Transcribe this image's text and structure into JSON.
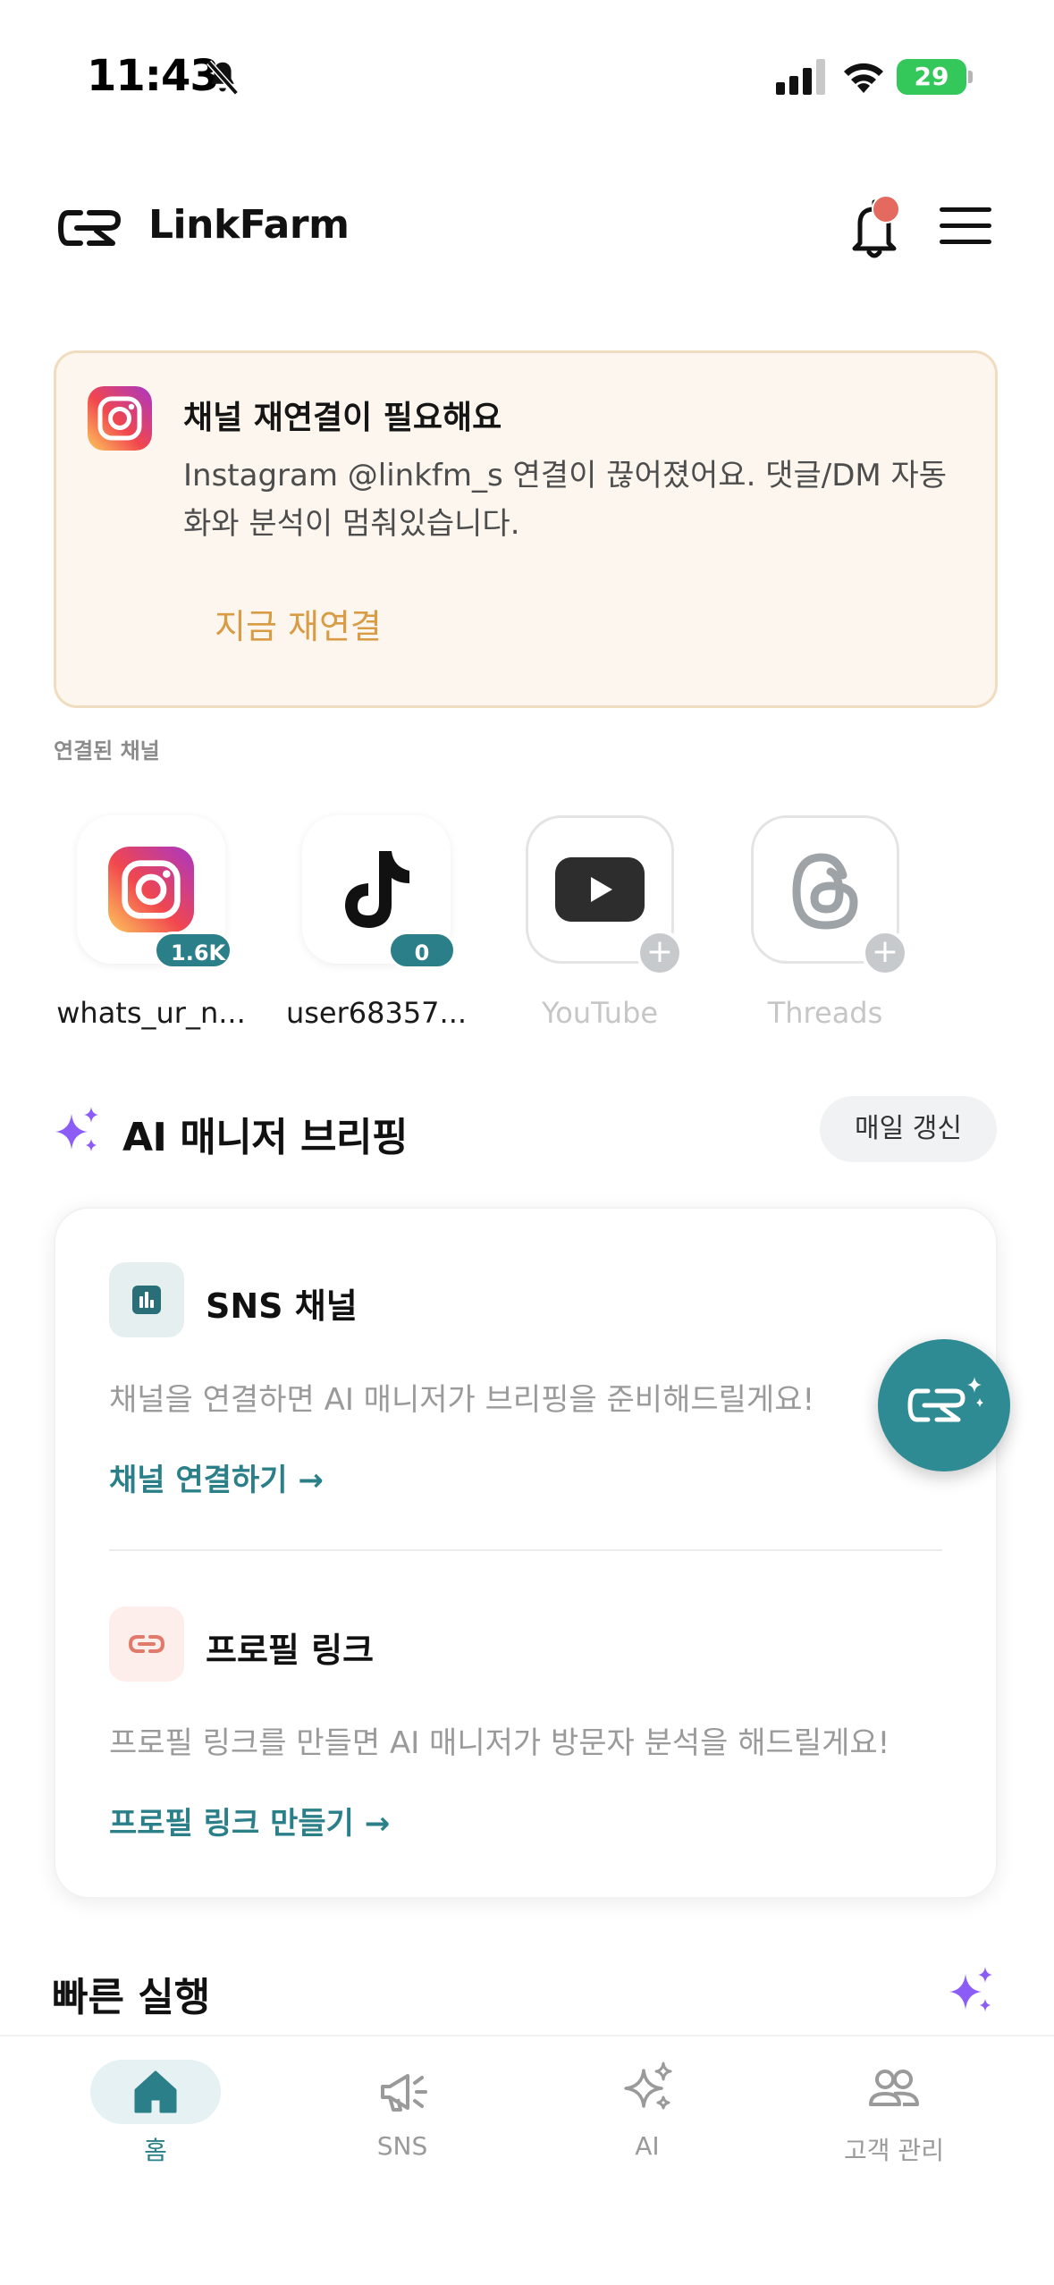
{
  "status_bar": {
    "time": "11:43",
    "battery": "29"
  },
  "header": {
    "brand": "LinkFarm"
  },
  "alert": {
    "title": "채널 재연결이 필요해요",
    "body": "Instagram @linkfm_s 연결이 끊어졌어요. 댓글/DM 자동화와 분석이 멈춰있습니다.",
    "action": "지금 재연결"
  },
  "channels": {
    "label": "연결된 채널",
    "items": [
      {
        "name": "whats_ur_n...",
        "badge": "1.6K",
        "icon": "instagram-icon",
        "connected": true
      },
      {
        "name": "user68357...",
        "badge": "0",
        "icon": "tiktok-icon",
        "connected": true
      },
      {
        "name": "YouTube",
        "badge": "",
        "icon": "youtube-icon",
        "connected": false
      },
      {
        "name": "Threads",
        "badge": "",
        "icon": "threads-icon",
        "connected": false
      }
    ]
  },
  "briefing": {
    "title": "AI 매니저 브리핑",
    "pill": "매일 갱신",
    "items": [
      {
        "title": "SNS 채널",
        "desc": "채널을 연결하면 AI 매니저가 브리핑을 준비해드릴게요!",
        "link": "채널 연결하기 →",
        "icon": "chart-icon"
      },
      {
        "title": "프로필 링크",
        "desc": "프로필 링크를 만들면 AI 매니저가 방문자 분석을 해드릴게요!",
        "link": "프로필 링크 만들기 →",
        "icon": "link-icon"
      }
    ]
  },
  "quick": {
    "title": "빠른 실행"
  },
  "nav": {
    "items": [
      {
        "label": "홈",
        "icon": "home-icon",
        "active": true
      },
      {
        "label": "SNS",
        "icon": "megaphone-icon",
        "active": false
      },
      {
        "label": "AI",
        "icon": "sparkle-icon",
        "active": false
      },
      {
        "label": "고객 관리",
        "icon": "users-icon",
        "active": false
      }
    ]
  },
  "colors": {
    "accent": "#2a7f88",
    "alert_bg": "#fcf6ee",
    "alert_action": "#d99b44",
    "notification_dot": "#e46a5f",
    "sparkle": "#8b5cf6"
  }
}
